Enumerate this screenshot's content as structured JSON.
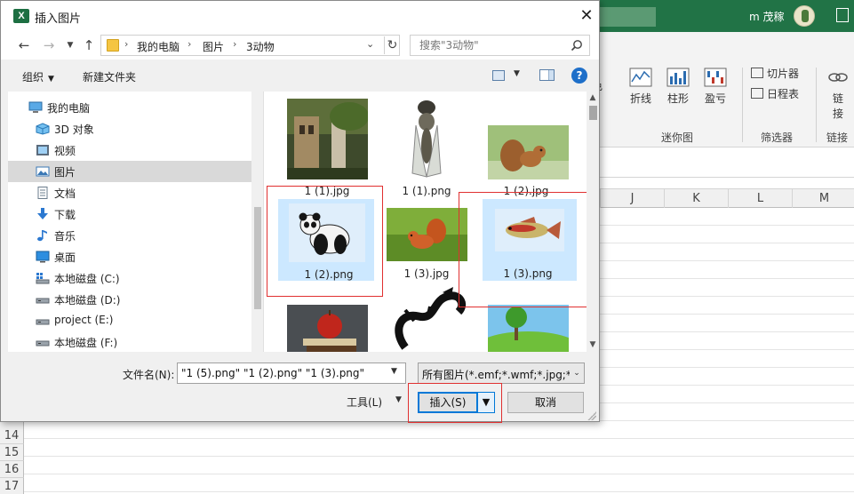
{
  "excel": {
    "user_name": "m 茂稼",
    "ribbon_buttons": [
      "折线",
      "柱形",
      "盈亏",
      "链接"
    ],
    "ribbon_partial_label": "色",
    "link_label_lines": [
      "链",
      "接"
    ],
    "small_buttons": [
      "切片器",
      "日程表"
    ],
    "groups": [
      "迷你图",
      "筛选器",
      "链接"
    ],
    "column_headers": [
      "J",
      "K",
      "L",
      "M"
    ],
    "row_headers": [
      "14",
      "15",
      "16",
      "17"
    ]
  },
  "dialog": {
    "title": "插入图片",
    "app_icon": "X",
    "breadcrumb": [
      "我的电脑",
      "图片",
      "3动物"
    ],
    "search_placeholder": "搜索\"3动物\"",
    "organize_label": "组织",
    "new_folder_label": "新建文件夹",
    "help_label": "?",
    "tree": [
      {
        "label": "我的电脑",
        "icon": "computer-icon"
      },
      {
        "label": "3D 对象",
        "icon": "3d-objects-icon"
      },
      {
        "label": "视频",
        "icon": "videos-icon"
      },
      {
        "label": "图片",
        "icon": "pictures-icon",
        "selected": true
      },
      {
        "label": "文档",
        "icon": "documents-icon"
      },
      {
        "label": "下载",
        "icon": "download-icon"
      },
      {
        "label": "音乐",
        "icon": "music-icon"
      },
      {
        "label": "桌面",
        "icon": "desktop-icon"
      },
      {
        "label": "本地磁盘 (C:)",
        "icon": "drive-icon"
      },
      {
        "label": "本地磁盘 (D:)",
        "icon": "drive-icon"
      },
      {
        "label": "project (E:)",
        "icon": "drive-icon"
      },
      {
        "label": "本地磁盘 (F:)",
        "icon": "drive-icon"
      }
    ],
    "files": [
      {
        "name": "1 (1).jpg",
        "picture": "building-in-forest",
        "selected": false
      },
      {
        "name": "1 (1).png",
        "picture": "cicada",
        "selected": false
      },
      {
        "name": "1 (2).jpg",
        "picture": "squirrel",
        "selected": false
      },
      {
        "name": "1 (2).png",
        "picture": "panda",
        "selected": true
      },
      {
        "name": "1 (3).jpg",
        "picture": "red-squirrel-on-grass",
        "selected": false
      },
      {
        "name": "1 (3).png",
        "picture": "fish",
        "selected": true
      },
      {
        "name": "",
        "picture": "apple-on-books",
        "selected": false
      },
      {
        "name": "",
        "picture": "black-dragon",
        "selected": false
      },
      {
        "name": "",
        "picture": "landscape-with-tree",
        "selected": false
      }
    ],
    "filename_label": "文件名(N):",
    "filename_value": "\"1 (5).png\" \"1 (2).png\" \"1 (3).png\"",
    "filetype_value": "所有图片(*.emf;*.wmf;*.jpg;*.jpeg;*.png;*.bmp;*.gif)",
    "tools_label": "工具(L)",
    "insert_label": "插入(S)",
    "cancel_label": "取消"
  },
  "colors": {
    "excel_green": "#217346",
    "selection_blue": "#cce8ff",
    "highlight_red": "#e03030",
    "primary_border": "#0078d7"
  }
}
